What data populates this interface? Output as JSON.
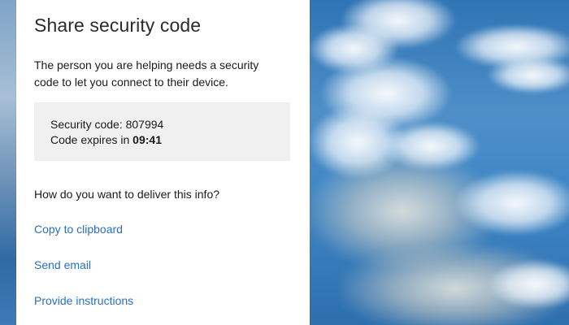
{
  "dialog": {
    "title": "Share security code",
    "description": "The person you are helping needs a security code to let you connect to their device.",
    "security_code_label": "Security code: ",
    "security_code_value": "807994",
    "expires_label": "Code expires in ",
    "expires_value": "09:41",
    "question": "How do you want to deliver this info?",
    "options": [
      {
        "label": "Copy to clipboard"
      },
      {
        "label": "Send email"
      },
      {
        "label": "Provide instructions"
      }
    ],
    "link_color": "#2a6fc0"
  }
}
